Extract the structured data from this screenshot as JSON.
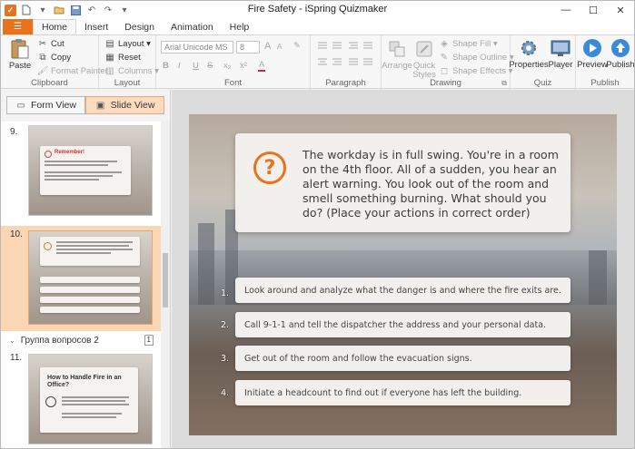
{
  "window": {
    "title": "Fire Safety - iSpring Quizmaker",
    "controls": {
      "minimize": "—",
      "maximize": "☐",
      "close": "✕"
    }
  },
  "quick_access": {
    "file_menu": "▾",
    "new": "🗋",
    "open": "▾",
    "save": "💾",
    "undo": "↶",
    "redo": "↷",
    "more": "▾"
  },
  "tabs": [
    "Home",
    "Insert",
    "Design",
    "Animation",
    "Help"
  ],
  "active_tab": "Home",
  "ribbon": {
    "clipboard": {
      "label": "Clipboard",
      "paste": "Paste",
      "cut": "Cut",
      "copy": "Copy",
      "format_painter": "Format Painter"
    },
    "layout": {
      "label": "Layout",
      "layout": "Layout ▾",
      "reset": "Reset",
      "columns": "Columns ▾"
    },
    "font": {
      "label": "Font",
      "family": "Arial Unicode MS",
      "size": "8",
      "bold": "B",
      "italic": "I",
      "underline": "U",
      "strike": "S",
      "subscript": "x₂",
      "superscript": "x²",
      "font_color": "A",
      "grow": "A",
      "shrink": "A"
    },
    "paragraph": {
      "label": "Paragraph"
    },
    "drawing": {
      "label": "Drawing",
      "arrange": "Arrange",
      "quick_styles": "Quick Styles",
      "shape_fill": "Shape Fill ▾",
      "shape_outline": "Shape Outline ▾",
      "shape_effects": "Shape Effects ▾"
    },
    "quiz": {
      "label": "Quiz",
      "properties": "Properties",
      "player": "Player"
    },
    "publish": {
      "label": "Publish",
      "preview": "Preview",
      "publish": "Publish"
    }
  },
  "view_tabs": {
    "form": "Form View",
    "slide": "Slide View"
  },
  "thumbnails": [
    {
      "num": "9.",
      "title": "Remember!"
    },
    {
      "num": "10."
    },
    {
      "group": "Группа вопросов 2",
      "count": "1"
    },
    {
      "num": "11.",
      "title": "How to Handle Fire in an Office?"
    }
  ],
  "slide": {
    "question": "The workday is in full swing. You're in a room on the 4th floor. All of a sudden, you hear an alert warning. You look out of the room and smell something burning. What should you do? (Place your actions in correct order)",
    "answers": [
      {
        "num": "1.",
        "text": "Look around and analyze what the danger is and where the fire exits are."
      },
      {
        "num": "2.",
        "text": "Call 9-1-1 and tell the dispatcher the address and your personal data."
      },
      {
        "num": "3.",
        "text": "Get out of the room and follow the evacuation signs."
      },
      {
        "num": "4.",
        "text": "Initiate a headcount to find out if everyone has left the building."
      }
    ]
  },
  "colors": {
    "accent": "#e8731c",
    "selected_thumb": "#fbd6b5"
  }
}
